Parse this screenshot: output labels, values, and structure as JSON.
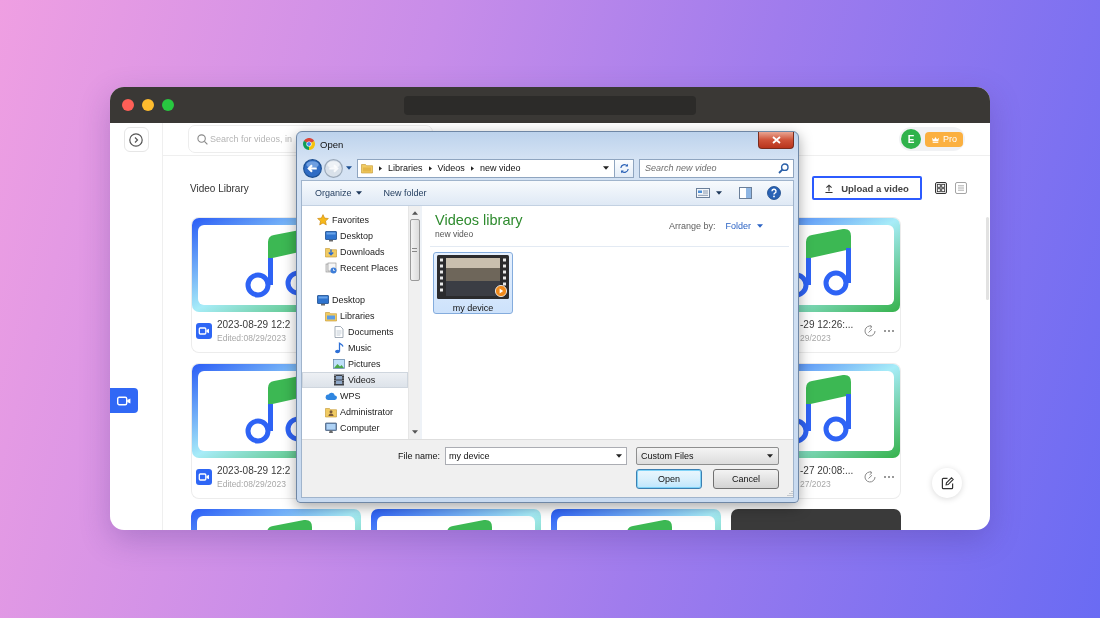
{
  "sidebar": {
    "video_tab": {
      "selected": true
    }
  },
  "header": {
    "search": {
      "placeholder": "Search for videos, in"
    },
    "account": {
      "initial": "E",
      "plan": "Pro"
    }
  },
  "library": {
    "title": "Video Library",
    "upload_button": "Upload a video",
    "view_modes": [
      {
        "kind": "grid",
        "selected": true
      },
      {
        "kind": "list",
        "selected": false
      }
    ],
    "cards": [
      {
        "kind": "audio",
        "title": "2023-08-29 12:2",
        "edited": "Edited:08/29/2023"
      },
      {
        "kind": "audio",
        "title": "-29 12:26:...",
        "edited": "29/2023"
      },
      {
        "kind": "audio",
        "title": "2023-08-29 12:2",
        "edited": "Edited:08/29/2023"
      },
      {
        "kind": "audio",
        "title": "-27 20:08:...",
        "edited": "27/2023"
      },
      {
        "kind": "audio"
      },
      {
        "kind": "audio"
      },
      {
        "kind": "audio"
      },
      {
        "kind": "video"
      }
    ]
  },
  "dialog": {
    "title": "Open",
    "nav_buttons": [
      {
        "kind": "back",
        "disabled": false
      },
      {
        "kind": "forward",
        "disabled": true
      }
    ],
    "breadcrumb": [
      "Libraries",
      "Videos",
      "new video"
    ],
    "search": {
      "placeholder": "Search new video"
    },
    "toolbar": [
      {
        "kind": "menu",
        "label": "Organize"
      },
      {
        "kind": "button",
        "label": "New folder"
      }
    ],
    "nav_tree": [
      {
        "label": "Favorites",
        "kind": "favorites",
        "selected": false,
        "children": [
          {
            "label": "Desktop",
            "kind": "desktop",
            "selected": false
          },
          {
            "label": "Downloads",
            "kind": "downloads",
            "selected": false
          },
          {
            "label": "Recent Places",
            "kind": "recent",
            "selected": false
          }
        ]
      },
      {
        "label": "Desktop",
        "kind": "desktop",
        "selected": false,
        "children": [
          {
            "label": "Libraries",
            "kind": "libraries",
            "selected": false,
            "children": [
              {
                "label": "Documents",
                "kind": "documents",
                "selected": false
              },
              {
                "label": "Music",
                "kind": "music",
                "selected": false
              },
              {
                "label": "Pictures",
                "kind": "pictures",
                "selected": false
              },
              {
                "label": "Videos",
                "kind": "videos",
                "selected": true
              }
            ]
          },
          {
            "label": "WPS",
            "kind": "cloud",
            "selected": false
          },
          {
            "label": "Administrator",
            "kind": "user",
            "selected": false
          },
          {
            "label": "Computer",
            "kind": "computer",
            "selected": false
          }
        ]
      }
    ],
    "folder": {
      "title": "Videos library",
      "subtitle": "new video",
      "arrange_label": "Arrange by:",
      "arrange_value": "Folder"
    },
    "files": [
      {
        "name": "my device",
        "selected": true
      }
    ],
    "file_name": {
      "label": "File name:",
      "value": "my device"
    },
    "file_type": "Custom Files",
    "buttons": [
      {
        "kind": "default",
        "label": "Open"
      },
      {
        "kind": "normal",
        "label": "Cancel"
      }
    ]
  }
}
